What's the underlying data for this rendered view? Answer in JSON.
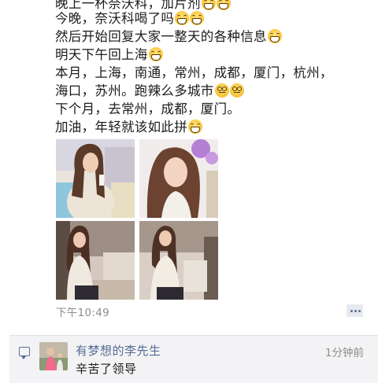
{
  "post": {
    "lines": [
      "晚上一杯奈沃科，加片剂",
      "今晚，奈沃科喝了吗",
      "然后开始回复大家一整天的各种信息",
      "明天下午回上海",
      "本月，上海，南通，常州，成都，厦门，杭州，",
      "海口，苏州。跑辣么多城市",
      "下个月，去常州，成都，厦门。",
      "加油，年轻就该如此拼"
    ],
    "line_emojis": [
      [
        "grin-icon",
        "grin-icon"
      ],
      [
        "grin-icon",
        "grin-icon"
      ],
      [
        "grin-icon"
      ],
      [
        "grin-icon"
      ],
      [],
      [
        "dizzy-icon",
        "dizzy-icon"
      ],
      [],
      [
        "grin-icon"
      ]
    ],
    "timestamp": "下午10:49",
    "more_icon": "ellipsis-icon"
  },
  "comments": {
    "items": [
      {
        "author": "有梦想的李先生",
        "time": "1分钟前",
        "text": "辛苦了领导"
      }
    ],
    "comment_icon": "comment-bubble-icon"
  },
  "colors": {
    "link": "#566b94",
    "timestamp": "#8c8c8c",
    "comment_bg": "#f3f3f5"
  }
}
